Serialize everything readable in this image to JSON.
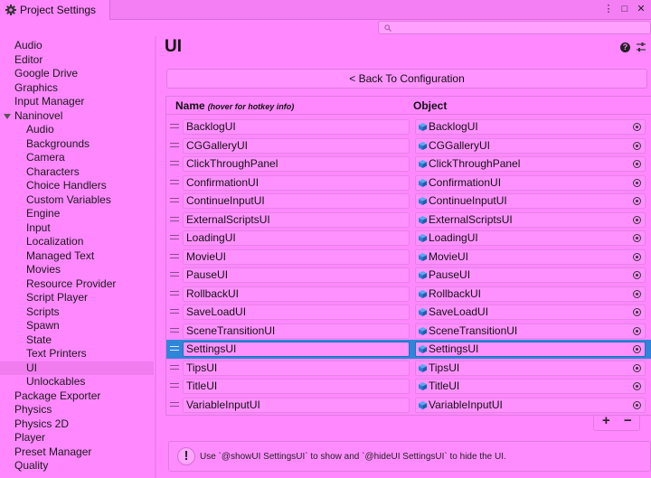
{
  "window": {
    "tab_title": "Project Settings",
    "menu_glyph": "⋮",
    "maximize_glyph": "□",
    "close_glyph": "✕"
  },
  "sidebar": {
    "items": [
      {
        "label": "Audio",
        "level": 0
      },
      {
        "label": "Editor",
        "level": 0
      },
      {
        "label": "Google Drive",
        "level": 0
      },
      {
        "label": "Graphics",
        "level": 0
      },
      {
        "label": "Input Manager",
        "level": 0
      },
      {
        "label": "Naninovel",
        "level": 0,
        "expanded": true
      },
      {
        "label": "Audio",
        "level": 1
      },
      {
        "label": "Backgrounds",
        "level": 1
      },
      {
        "label": "Camera",
        "level": 1
      },
      {
        "label": "Characters",
        "level": 1
      },
      {
        "label": "Choice Handlers",
        "level": 1
      },
      {
        "label": "Custom Variables",
        "level": 1
      },
      {
        "label": "Engine",
        "level": 1
      },
      {
        "label": "Input",
        "level": 1
      },
      {
        "label": "Localization",
        "level": 1
      },
      {
        "label": "Managed Text",
        "level": 1
      },
      {
        "label": "Movies",
        "level": 1
      },
      {
        "label": "Resource Provider",
        "level": 1
      },
      {
        "label": "Script Player",
        "level": 1
      },
      {
        "label": "Scripts",
        "level": 1
      },
      {
        "label": "Spawn",
        "level": 1
      },
      {
        "label": "State",
        "level": 1
      },
      {
        "label": "Text Printers",
        "level": 1
      },
      {
        "label": "UI",
        "level": 1,
        "selected": true
      },
      {
        "label": "Unlockables",
        "level": 1
      },
      {
        "label": "Package Exporter",
        "level": 0
      },
      {
        "label": "Physics",
        "level": 0
      },
      {
        "label": "Physics 2D",
        "level": 0
      },
      {
        "label": "Player",
        "level": 0
      },
      {
        "label": "Preset Manager",
        "level": 0
      },
      {
        "label": "Quality",
        "level": 0
      }
    ]
  },
  "main": {
    "title": "UI",
    "help_glyph": "?",
    "back_button": "< Back To Configuration",
    "header_name": "Name",
    "header_hint": "(hover for hotkey info)",
    "header_object": "Object",
    "rows": [
      {
        "name": "BacklogUI",
        "object": "BacklogUI"
      },
      {
        "name": "CGGalleryUI",
        "object": "CGGalleryUI"
      },
      {
        "name": "ClickThroughPanel",
        "object": "ClickThroughPanel"
      },
      {
        "name": "ConfirmationUI",
        "object": "ConfirmationUI"
      },
      {
        "name": "ContinueInputUI",
        "object": "ContinueInputUI"
      },
      {
        "name": "ExternalScriptsUI",
        "object": "ExternalScriptsUI"
      },
      {
        "name": "LoadingUI",
        "object": "LoadingUI"
      },
      {
        "name": "MovieUI",
        "object": "MovieUI"
      },
      {
        "name": "PauseUI",
        "object": "PauseUI"
      },
      {
        "name": "RollbackUI",
        "object": "RollbackUI"
      },
      {
        "name": "SaveLoadUI",
        "object": "SaveLoadUI"
      },
      {
        "name": "SceneTransitionUI",
        "object": "SceneTransitionUI"
      },
      {
        "name": "SettingsUI",
        "object": "SettingsUI",
        "selected": true
      },
      {
        "name": "TipsUI",
        "object": "TipsUI"
      },
      {
        "name": "TitleUI",
        "object": "TitleUI"
      },
      {
        "name": "VariableInputUI",
        "object": "VariableInputUI"
      }
    ],
    "add_glyph": "+",
    "remove_glyph": "−",
    "info_glyph": "!",
    "info_text": "Use `@showUI SettingsUI` to show and `@hideUI SettingsUI` to hide the UI."
  },
  "colors": {
    "background": "#ff88ff",
    "selection": "#2f86d8",
    "prefab_icon": "#2a7fd6"
  }
}
